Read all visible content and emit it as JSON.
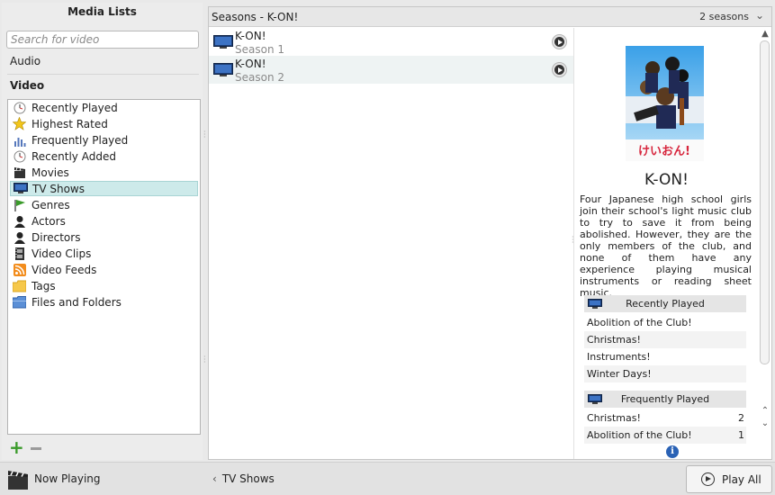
{
  "left_panel": {
    "title": "Media Lists",
    "search_placeholder": "Search for video",
    "audio_label": "Audio",
    "video_label": "Video",
    "items": [
      {
        "label": "Recently Played",
        "icon": "clock-icon"
      },
      {
        "label": "Highest Rated",
        "icon": "star-icon"
      },
      {
        "label": "Frequently Played",
        "icon": "bar-chart-icon"
      },
      {
        "label": "Recently Added",
        "icon": "clock-icon"
      },
      {
        "label": "Movies",
        "icon": "clapperboard-icon"
      },
      {
        "label": "TV Shows",
        "icon": "tv-icon",
        "selected": true
      },
      {
        "label": "Genres",
        "icon": "flag-icon"
      },
      {
        "label": "Actors",
        "icon": "person-icon"
      },
      {
        "label": "Directors",
        "icon": "person-icon"
      },
      {
        "label": "Video Clips",
        "icon": "film-icon"
      },
      {
        "label": "Video Feeds",
        "icon": "rss-icon"
      },
      {
        "label": "Tags",
        "icon": "tag-folder-icon"
      },
      {
        "label": "Files and Folders",
        "icon": "folder-icon"
      }
    ]
  },
  "main": {
    "title": "Seasons - K-ON!",
    "season_count": "2 seasons",
    "seasons": [
      {
        "name": "K-ON!",
        "subtitle": "Season 1"
      },
      {
        "name": "K-ON!",
        "subtitle": "Season 2"
      }
    ]
  },
  "detail": {
    "show_title": "K-ON!",
    "poster_text": "けいおん!",
    "description": "Four Japanese high school girls join their school's light music club to try to save it from being abolished. However, they are the only members of the club, and none of them have any experience playing musical instruments or reading sheet music.",
    "recently_played": {
      "heading": "Recently Played",
      "episodes": [
        "Abolition of the Club!",
        "Christmas!",
        "Instruments!",
        "Winter Days!"
      ]
    },
    "frequently_played": {
      "heading": "Frequently Played",
      "episodes": [
        {
          "title": "Christmas!",
          "count": "2"
        },
        {
          "title": "Abolition of the Club!",
          "count": "1"
        }
      ]
    }
  },
  "bottom_bar": {
    "now_playing": "Now Playing",
    "back_label": "TV Shows",
    "play_all": "Play All"
  },
  "colors": {
    "selection": "#cdeaea",
    "info_blue": "#2a62b5",
    "add_green": "#3a9a2a"
  }
}
